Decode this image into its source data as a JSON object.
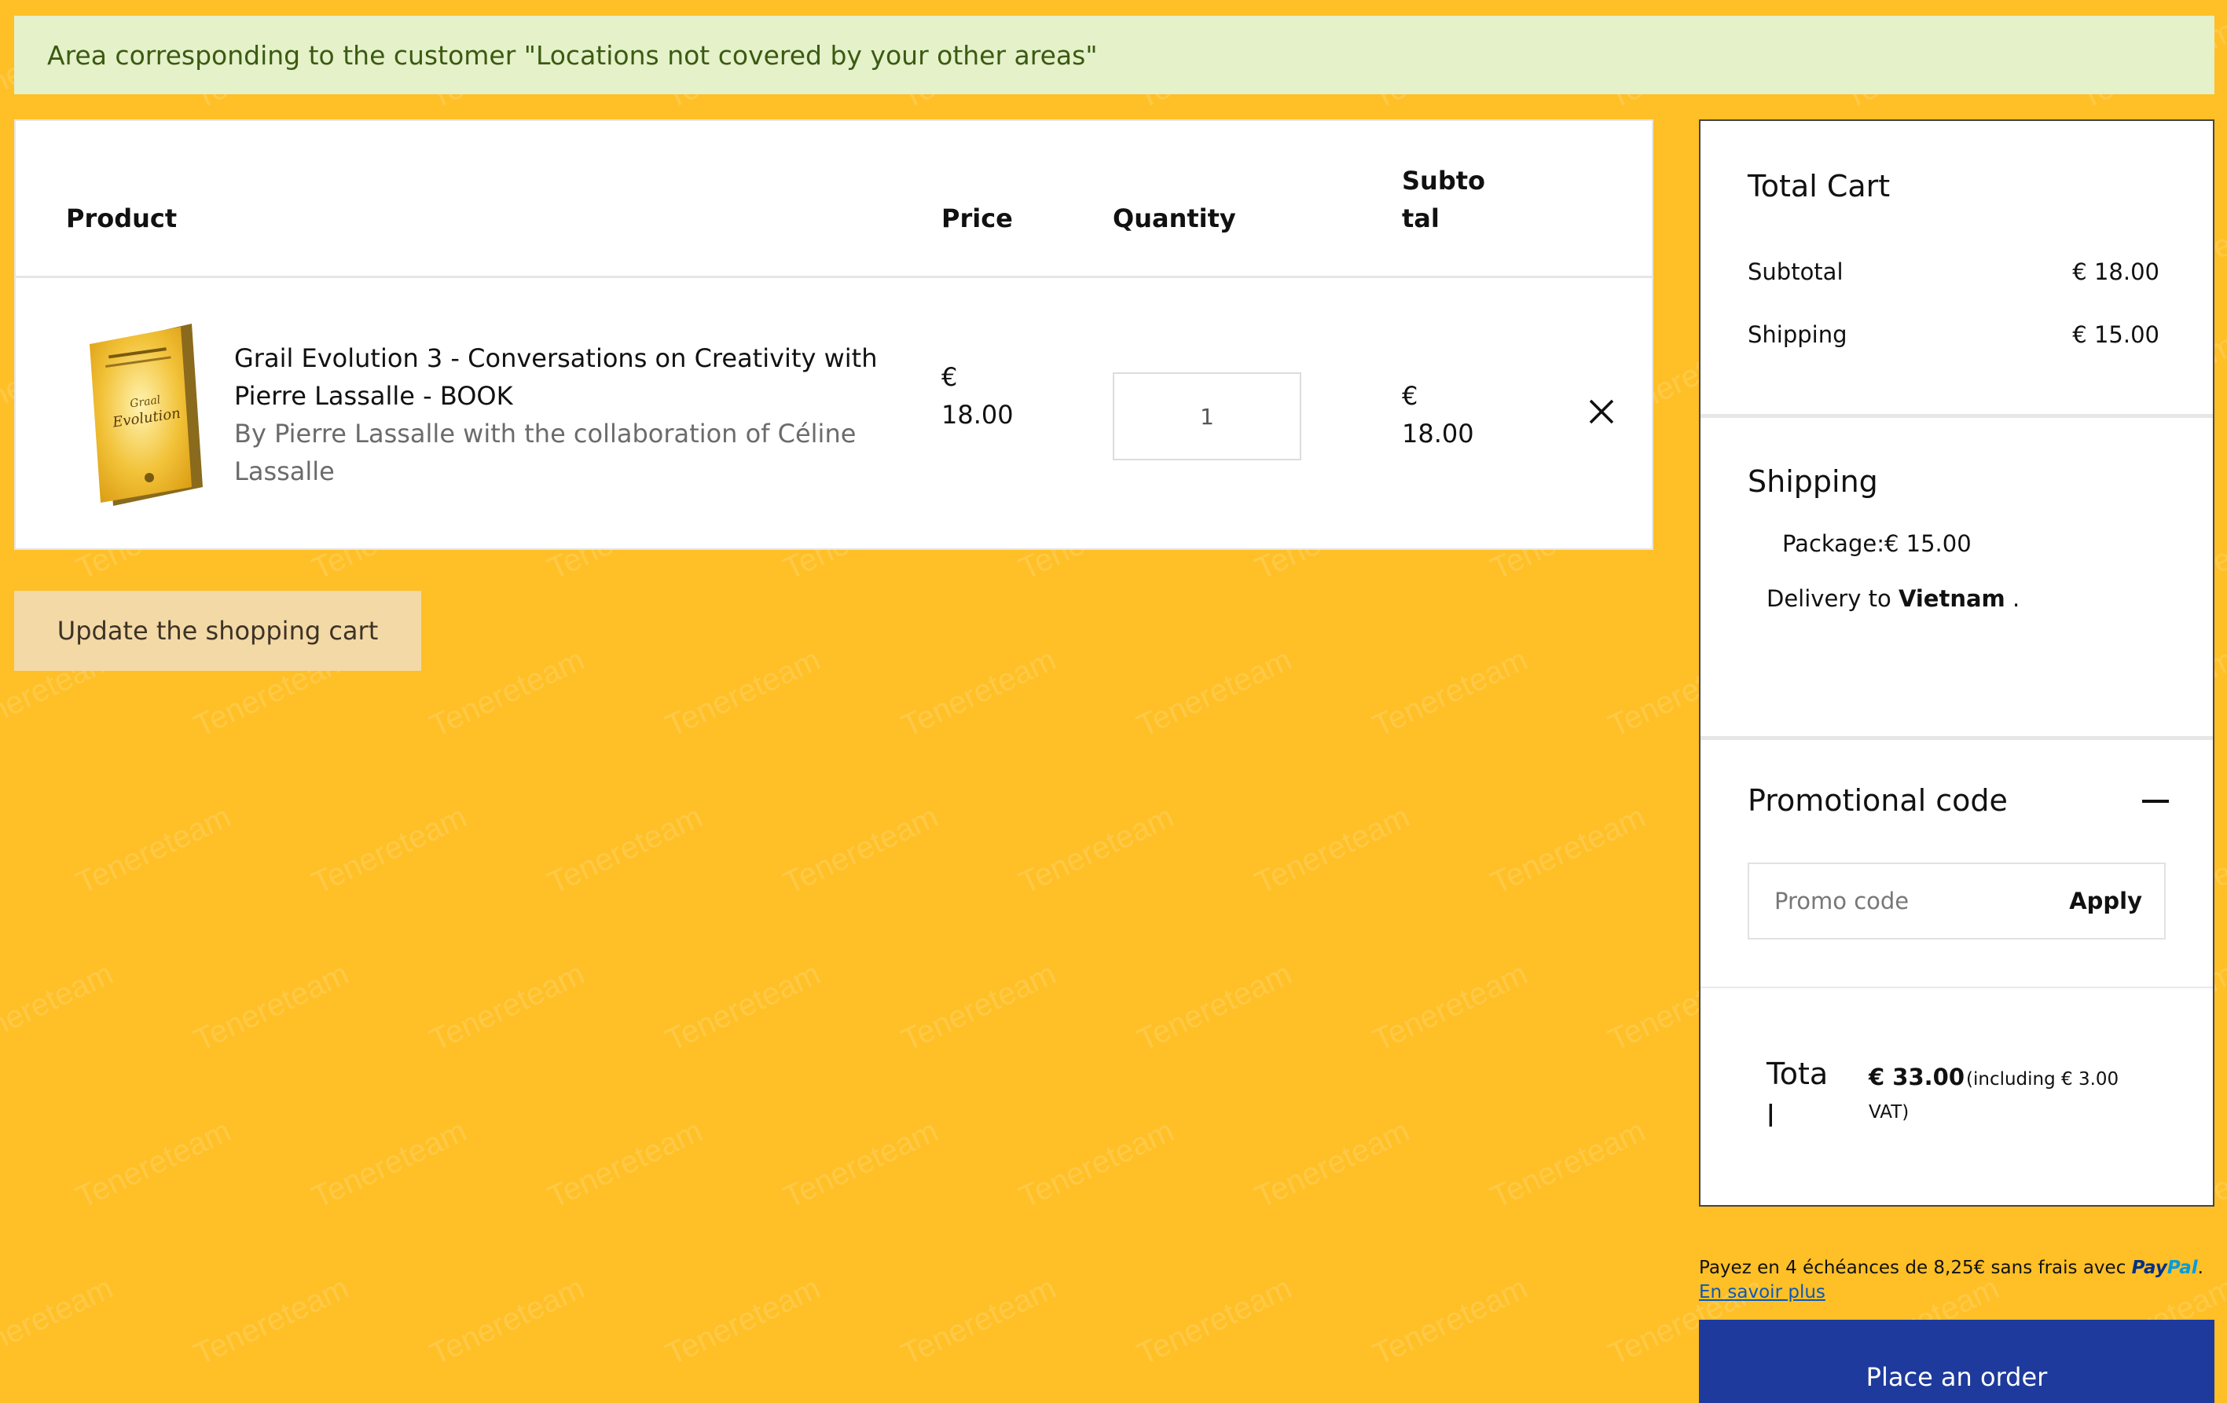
{
  "notice": {
    "text": "Area corresponding to the customer \"Locations not covered by your other areas\""
  },
  "cart": {
    "headers": {
      "product": "Product",
      "price": "Price",
      "quantity": "Quantity",
      "subtotal": "Subto tal"
    },
    "items": [
      {
        "title": "Grail Evolution 3 - Conversations on Creativity with Pierre Lassalle - BOOK",
        "author": "By Pierre Lassalle with the collaboration of Céline Lassalle",
        "price": "€ 18.00",
        "quantity": "1",
        "subtotal": "€ 18.00",
        "cover_text": "Graal Evolution"
      }
    ],
    "update_label": "Update the shopping cart"
  },
  "summary": {
    "total_cart_title": "Total Cart",
    "subtotal_label": "Subtotal",
    "subtotal_value": "€ 18.00",
    "shipping_label": "Shipping",
    "shipping_value": "€ 15.00",
    "shipping_title": "Shipping",
    "package_label": "Package:",
    "package_value": "€ 15.00",
    "delivery_prefix": "Delivery to",
    "delivery_country": "Vietnam",
    "delivery_suffix": ".",
    "promo_title": "Promotional code",
    "promo_placeholder": "Promo code",
    "apply_label": "Apply",
    "total_label": "Total",
    "total_value": "€ 33.00",
    "total_vat": "(including € 3.00 VAT)"
  },
  "paypal": {
    "text": "Payez en 4 échéances de 8,25€ sans frais avec",
    "logo_pay": "Pay",
    "logo_pal": "Pal",
    "learn_more": "En savoir plus"
  },
  "order_button": "Place an order",
  "watermark_text": "Tenereteam",
  "colors": {
    "page_bg": "#FFBF26",
    "notice_bg": "#E4F1C9",
    "order_button": "#1E3A9C"
  }
}
